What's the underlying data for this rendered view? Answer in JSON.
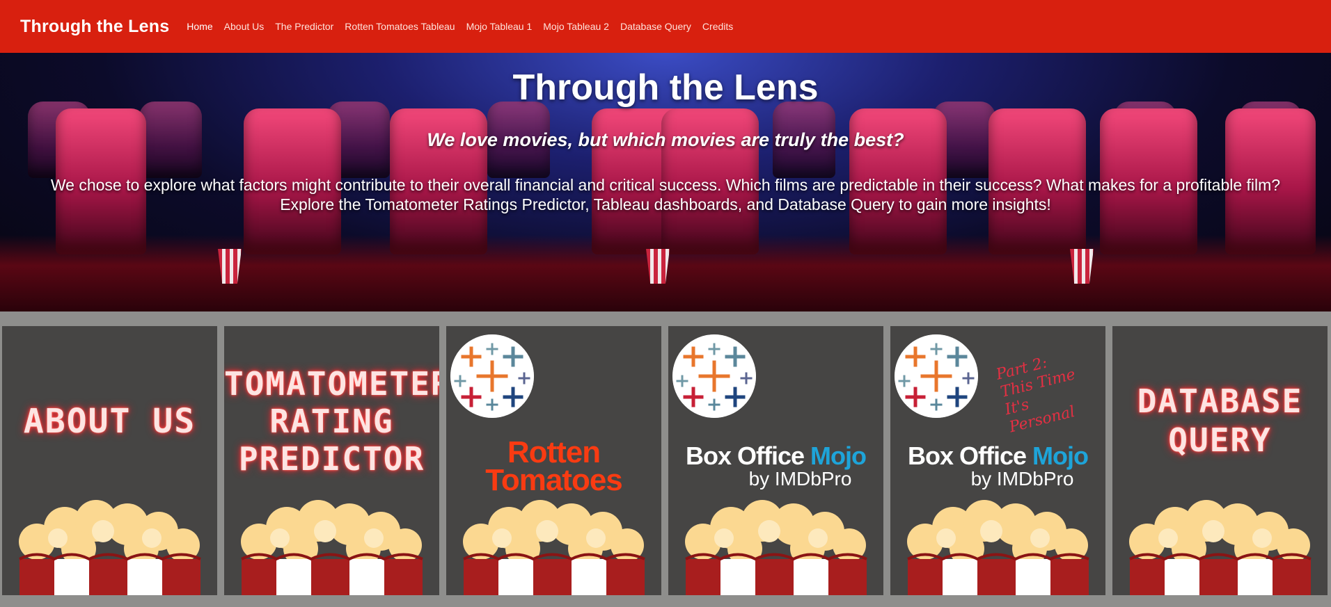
{
  "navbar": {
    "brand": "Through the Lens",
    "items": [
      {
        "label": "Home",
        "active": true
      },
      {
        "label": "About Us"
      },
      {
        "label": "The Predictor"
      },
      {
        "label": "Rotten Tomatoes Tableau"
      },
      {
        "label": "Mojo Tableau 1"
      },
      {
        "label": "Mojo Tableau 2"
      },
      {
        "label": "Database Query"
      },
      {
        "label": "Credits"
      }
    ]
  },
  "hero": {
    "title": "Through the Lens",
    "subtitle": "We love movies, but which movies are truly the best?",
    "description": "We chose to explore what factors might contribute to their overall financial and critical success. Which films are predictable in their success? What makes for a profitable film? Explore the Tomatometer Ratings Predictor, Tableau dashboards, and Database Query to gain more insights!"
  },
  "cards": [
    {
      "neon_lines": [
        "ABOUT US"
      ]
    },
    {
      "neon_lines": [
        "TOMATOMETER",
        "RATING",
        "PREDICTOR"
      ]
    },
    {
      "logo_lines": [
        "Rotten",
        "Tomatoes"
      ]
    },
    {
      "logo_main": "Box Office",
      "logo_accent": "Mojo",
      "logo_sub": "by IMDbPro"
    },
    {
      "logo_main": "Box Office",
      "logo_accent": "Mojo",
      "logo_sub": "by IMDbPro",
      "handwritten_lines": [
        "Part 2:",
        "This Time It's",
        "Personal"
      ]
    },
    {
      "neon_lines": [
        "DATABASE",
        "QUERY"
      ]
    }
  ],
  "colors": {
    "navbar": "#d8200f",
    "card_bg": "#464544",
    "page_bg": "#8e8e8c",
    "neon": "#ff3b3b",
    "rotten_tomatoes": "#f93b12",
    "mojo_blue": "#1ea4d9"
  }
}
